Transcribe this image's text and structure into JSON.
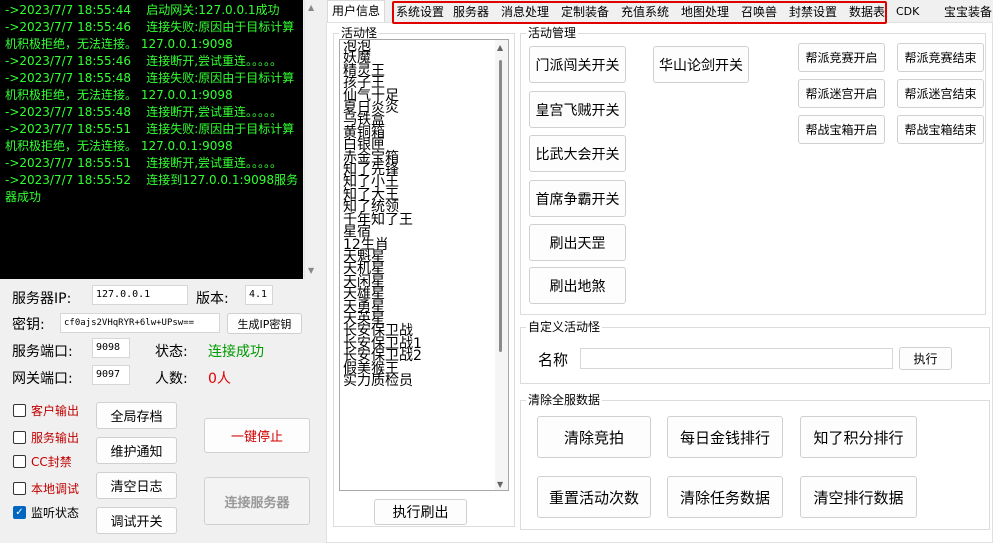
{
  "log": {
    "lines": [
      "->2023/7/7 18:55:44    启动网关:127.0.0.1成功",
      "->2023/7/7 18:55:46    连接失败:原因由于目标计算机积极拒绝，无法连接。 127.0.0.1:9098",
      "->2023/7/7 18:55:46    连接断开,尝试重连。。。。。",
      "->2023/7/7 18:55:48    连接失败:原因由于目标计算机积极拒绝，无法连接。 127.0.0.1:9098",
      "->2023/7/7 18:55:48    连接断开,尝试重连。。。。。",
      "->2023/7/7 18:55:51    连接失败:原因由于目标计算机积极拒绝，无法连接。 127.0.0.1:9098",
      "->2023/7/7 18:55:51    连接断开,尝试重连。。。。。",
      "->2023/7/7 18:55:52    连接到127.0.0.1:9098服务器成功"
    ]
  },
  "server": {
    "ip_label": "服务器IP:",
    "ip_value": "127.0.0.1",
    "version_label": "版本:",
    "version_value": "4.1",
    "key_label": "密钥:",
    "key_value": "cf0ajs2VHqRYR+6lw+UPsw==",
    "gen_key_button": "生成IP密钥",
    "port_label": "服务端口:",
    "port_value": "9098",
    "status_label": "状态:",
    "status_value": "连接成功",
    "gateway_port_label": "网关端口:",
    "gateway_port_value": "9097",
    "count_label": "人数:",
    "count_value": "0人"
  },
  "checkboxes": [
    {
      "label": "客户输出",
      "checked": false
    },
    {
      "label": "服务输出",
      "checked": false
    },
    {
      "label": "CC封禁",
      "checked": false
    },
    {
      "label": "本地调试",
      "checked": false
    },
    {
      "label": "监听状态",
      "checked": true
    }
  ],
  "actions": {
    "save_all": "全局存档",
    "maintenance": "维护通知",
    "clear_log": "清空日志",
    "debug_switch": "调试开关",
    "stop_all": "一键停止",
    "connect_server": "连接服务器"
  },
  "tabs": [
    {
      "label": "用户信息",
      "active": true
    },
    {
      "label": "系统设置"
    },
    {
      "label": "服务器"
    },
    {
      "label": "消息处理"
    },
    {
      "label": "定制装备"
    },
    {
      "label": "充值系统"
    },
    {
      "label": "地图处理"
    },
    {
      "label": "召唤兽"
    },
    {
      "label": "封禁设置"
    },
    {
      "label": "数据表"
    },
    {
      "label": "CDK"
    },
    {
      "label": "宝宝装备"
    }
  ],
  "activity_monsters": {
    "title": "活动怪",
    "items": [
      "泡泡",
      "妖魔",
      "精灵王",
      "孩子王",
      "仙气十足",
      "夏日炎炎",
      "乌铁盒",
      "黄铜箱",
      "白银匣",
      "赤金宝箱",
      "知了先锋",
      "知了小王",
      "知了大王",
      "知了统领",
      "千年知了王",
      "星宿",
      "12生肖",
      "天魁星",
      "天机星",
      "天闲星",
      "天雄星",
      "天勇星",
      "天英星",
      "长安保卫战",
      "长安保卫战1",
      "长安保卫战2",
      "假美猴王",
      "实力质检员"
    ],
    "refresh_button": "执行刷出"
  },
  "activity_mgmt": {
    "title": "活动管理",
    "left_buttons": [
      "门派闯关开关",
      "皇宫飞贼开关",
      "比武大会开关",
      "首席争霸开关",
      "刷出天罡",
      "刷出地煞"
    ],
    "huashan": "华山论剑开关",
    "gang_buttons": [
      "帮派竞赛开启",
      "帮派竞赛结束",
      "帮派迷宫开启",
      "帮派迷宫结束",
      "帮战宝箱开启",
      "帮战宝箱结束"
    ]
  },
  "custom_monster": {
    "title": "自定义活动怪",
    "name_label": "名称",
    "name_value": "",
    "execute": "执行"
  },
  "clear_data": {
    "title": "清除全服数据",
    "buttons": [
      "清除竞拍",
      "每日金钱排行",
      "知了积分排行",
      "重置活动次数",
      "清除任务数据",
      "清空排行数据"
    ]
  },
  "colors": {
    "log_text": "#33ff33",
    "status_ok": "#009900",
    "count": "#e00000",
    "highlight": "#e00000"
  }
}
